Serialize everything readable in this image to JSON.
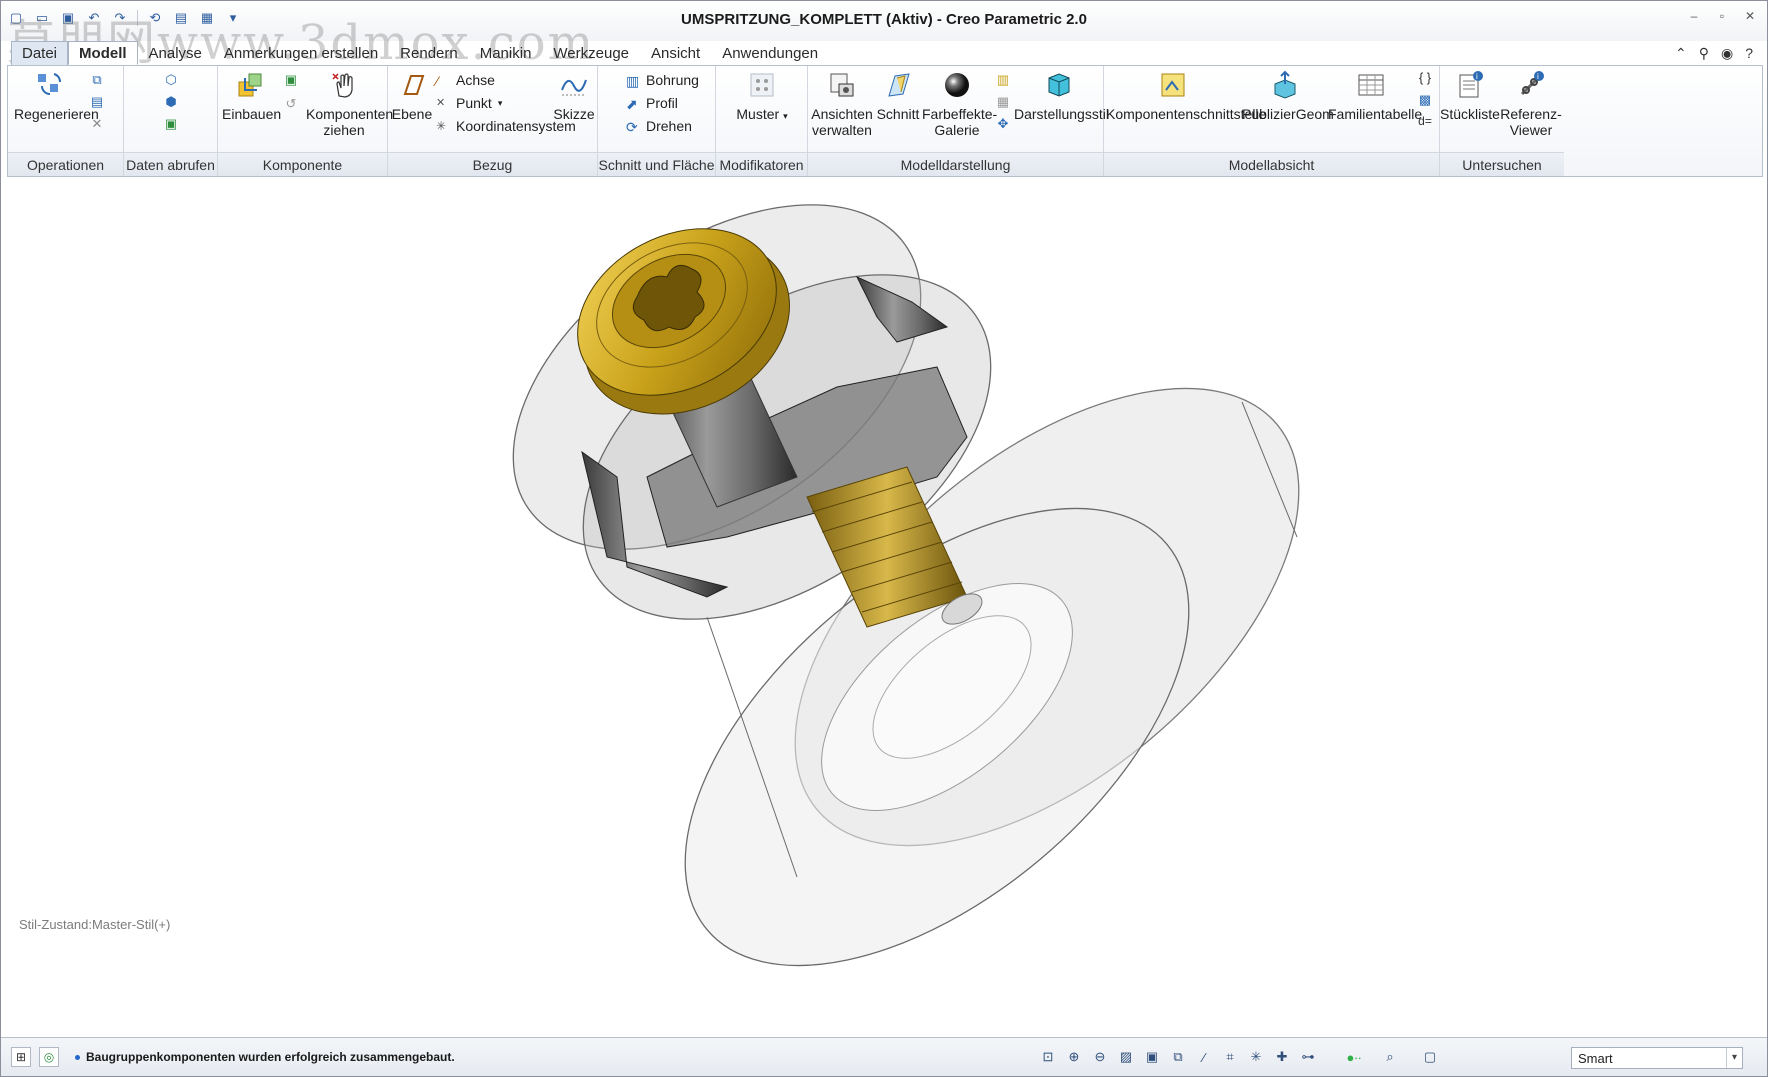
{
  "window": {
    "title": "UMSPRITZUNG_KOMPLETT (Aktiv) - Creo Parametric 2.0",
    "watermark": "莫朋网www.3dmox.com"
  },
  "tabs": [
    {
      "label": "Datei"
    },
    {
      "label": "Modell"
    },
    {
      "label": "Analyse"
    },
    {
      "label": "Anmerkungen erstellen"
    },
    {
      "label": "Rendern"
    },
    {
      "label": "Manikin"
    },
    {
      "label": "Werkzeuge"
    },
    {
      "label": "Ansicht"
    },
    {
      "label": "Anwendungen"
    }
  ],
  "ribbon": {
    "operationen": {
      "label": "Operationen",
      "regenerieren": "Regenerieren"
    },
    "daten_abrufen": {
      "label": "Daten abrufen"
    },
    "komponente": {
      "label": "Komponente",
      "einbauen": "Einbauen",
      "komponenten_ziehen_1": "Komponenten",
      "komponenten_ziehen_2": "ziehen"
    },
    "bezug": {
      "label": "Bezug",
      "ebene": "Ebene",
      "achse": "Achse",
      "punkt": "Punkt",
      "koordinatensystem": "Koordinatensystem",
      "skizze": "Skizze"
    },
    "schnitt": {
      "label": "Schnitt und Fläche",
      "bohrung": "Bohrung",
      "profil": "Profil",
      "drehen": "Drehen"
    },
    "modifikatoren": {
      "label": "Modifikatoren",
      "muster": "Muster"
    },
    "modelldarstellung": {
      "label": "Modelldarstellung",
      "ansichten_1": "Ansichten",
      "ansichten_2": "verwalten",
      "schnitt": "Schnitt",
      "farbeffekte_1": "Farbeffekte-",
      "farbeffekte_2": "Galerie",
      "darstellungsstil": "Darstellungsstil"
    },
    "modellabsicht": {
      "label": "Modellabsicht",
      "komponentenschnittstelle": "Komponentenschnittstelle",
      "publiziergeom": "PublizierGeom",
      "familientabelle": "Familientabelle"
    },
    "untersuchen": {
      "label": "Untersuchen",
      "stueckliste": "Stückliste",
      "referenz_1": "Referenz-",
      "referenz_2": "Viewer"
    }
  },
  "viewport": {
    "style_state": "Stil-Zustand:Master-Stil(+)"
  },
  "status": {
    "message": "Baugruppenkomponenten wurden erfolgreich zusammengebaut.",
    "filter_value": "Smart"
  },
  "colors": {
    "gold": "#c9a21a",
    "steel": "#6e6e6e",
    "accent": "#2d6bb4"
  }
}
